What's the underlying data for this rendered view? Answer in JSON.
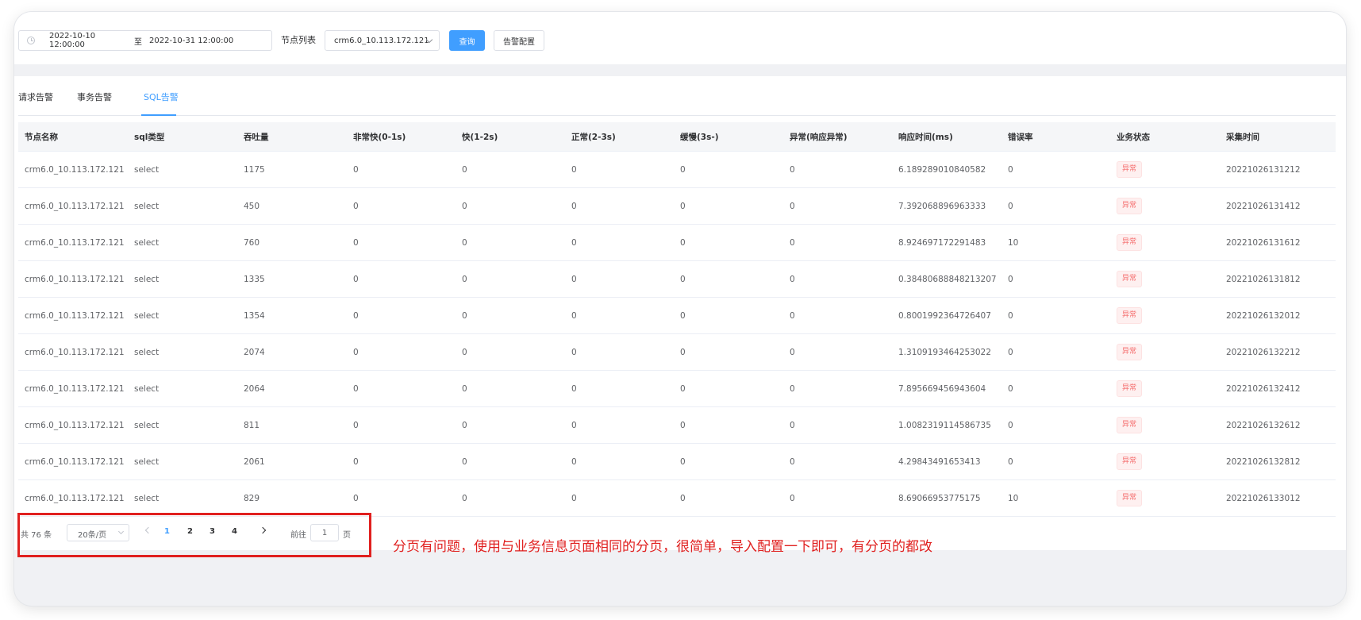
{
  "filter": {
    "date_start": "2022-10-10 12:00:00",
    "date_separator": "至",
    "date_end": "2022-10-31 12:00:00",
    "node_label": "节点列表",
    "node_value": "crm6.0_10.113.172.121",
    "query_button": "查询",
    "config_button": "告警配置"
  },
  "tabs": [
    {
      "label": "请求告警",
      "active": false
    },
    {
      "label": "事务告警",
      "active": false
    },
    {
      "label": "SQL告警",
      "active": true
    }
  ],
  "table": {
    "columns": [
      "节点名称",
      "sql类型",
      "吞吐量",
      "非常快(0-1s)",
      "快(1-2s)",
      "正常(2-3s)",
      "缓慢(3s-)",
      "异常(响应异常)",
      "响应时间(ms)",
      "错误率",
      "业务状态",
      "采集时间"
    ],
    "rows": [
      [
        "crm6.0_10.113.172.121",
        "select",
        "1175",
        "0",
        "0",
        "0",
        "0",
        "0",
        "6.189289010840582",
        "0",
        "异常",
        "20221026131212"
      ],
      [
        "crm6.0_10.113.172.121",
        "select",
        "450",
        "0",
        "0",
        "0",
        "0",
        "0",
        "7.392068896963333",
        "0",
        "异常",
        "20221026131412"
      ],
      [
        "crm6.0_10.113.172.121",
        "select",
        "760",
        "0",
        "0",
        "0",
        "0",
        "0",
        "8.924697172291483",
        "10",
        "异常",
        "20221026131612"
      ],
      [
        "crm6.0_10.113.172.121",
        "select",
        "1335",
        "0",
        "0",
        "0",
        "0",
        "0",
        "0.38480688848213207",
        "0",
        "异常",
        "20221026131812"
      ],
      [
        "crm6.0_10.113.172.121",
        "select",
        "1354",
        "0",
        "0",
        "0",
        "0",
        "0",
        "0.8001992364726407",
        "0",
        "异常",
        "20221026132012"
      ],
      [
        "crm6.0_10.113.172.121",
        "select",
        "2074",
        "0",
        "0",
        "0",
        "0",
        "0",
        "1.3109193464253022",
        "0",
        "异常",
        "20221026132212"
      ],
      [
        "crm6.0_10.113.172.121",
        "select",
        "2064",
        "0",
        "0",
        "0",
        "0",
        "0",
        "7.895669456943604",
        "0",
        "异常",
        "20221026132412"
      ],
      [
        "crm6.0_10.113.172.121",
        "select",
        "811",
        "0",
        "0",
        "0",
        "0",
        "0",
        "1.0082319114586735",
        "0",
        "异常",
        "20221026132612"
      ],
      [
        "crm6.0_10.113.172.121",
        "select",
        "2061",
        "0",
        "0",
        "0",
        "0",
        "0",
        "4.29843491653413",
        "0",
        "异常",
        "20221026132812"
      ],
      [
        "crm6.0_10.113.172.121",
        "select",
        "829",
        "0",
        "0",
        "0",
        "0",
        "0",
        "8.69066953775175",
        "10",
        "异常",
        "20221026133012"
      ]
    ]
  },
  "pagination": {
    "total": "共 76 条",
    "page_size": "20条/页",
    "pages": [
      "1",
      "2",
      "3",
      "4"
    ],
    "current": "1",
    "goto_label": "前往",
    "goto_value": "1",
    "goto_unit": "页"
  },
  "annotation": {
    "text": "分页有问题，使用与业务信息页面相同的分页，很简单，导入配置一下即可，有分页的都改",
    "color": "#e0201f"
  },
  "colors": {
    "accent": "#409eff",
    "danger": "#f56c6c"
  }
}
